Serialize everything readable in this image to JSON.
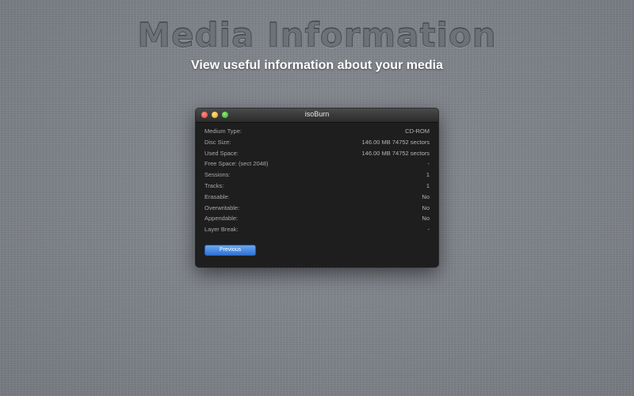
{
  "hero": {
    "title": "Media Information",
    "subtitle": "View useful information about your media"
  },
  "window": {
    "title": "isoBurn",
    "rows": [
      {
        "label": "Medium Type:",
        "value": "CD-ROM"
      },
      {
        "label": "Disc Size:",
        "value": "146.00 MB 74752 sectors"
      },
      {
        "label": "Used Space:",
        "value": "146.00 MB 74752 sectors"
      },
      {
        "label": "Free Space: (sect 2048)",
        "value": "-"
      },
      {
        "label": "Sessions:",
        "value": "1"
      },
      {
        "label": "Tracks:",
        "value": "1"
      },
      {
        "label": "Erasable:",
        "value": "No"
      },
      {
        "label": "Overwritable:",
        "value": "No"
      },
      {
        "label": "Appendable:",
        "value": "No"
      },
      {
        "label": "Layer Break:",
        "value": "-"
      }
    ],
    "previous_label": "Previous"
  }
}
